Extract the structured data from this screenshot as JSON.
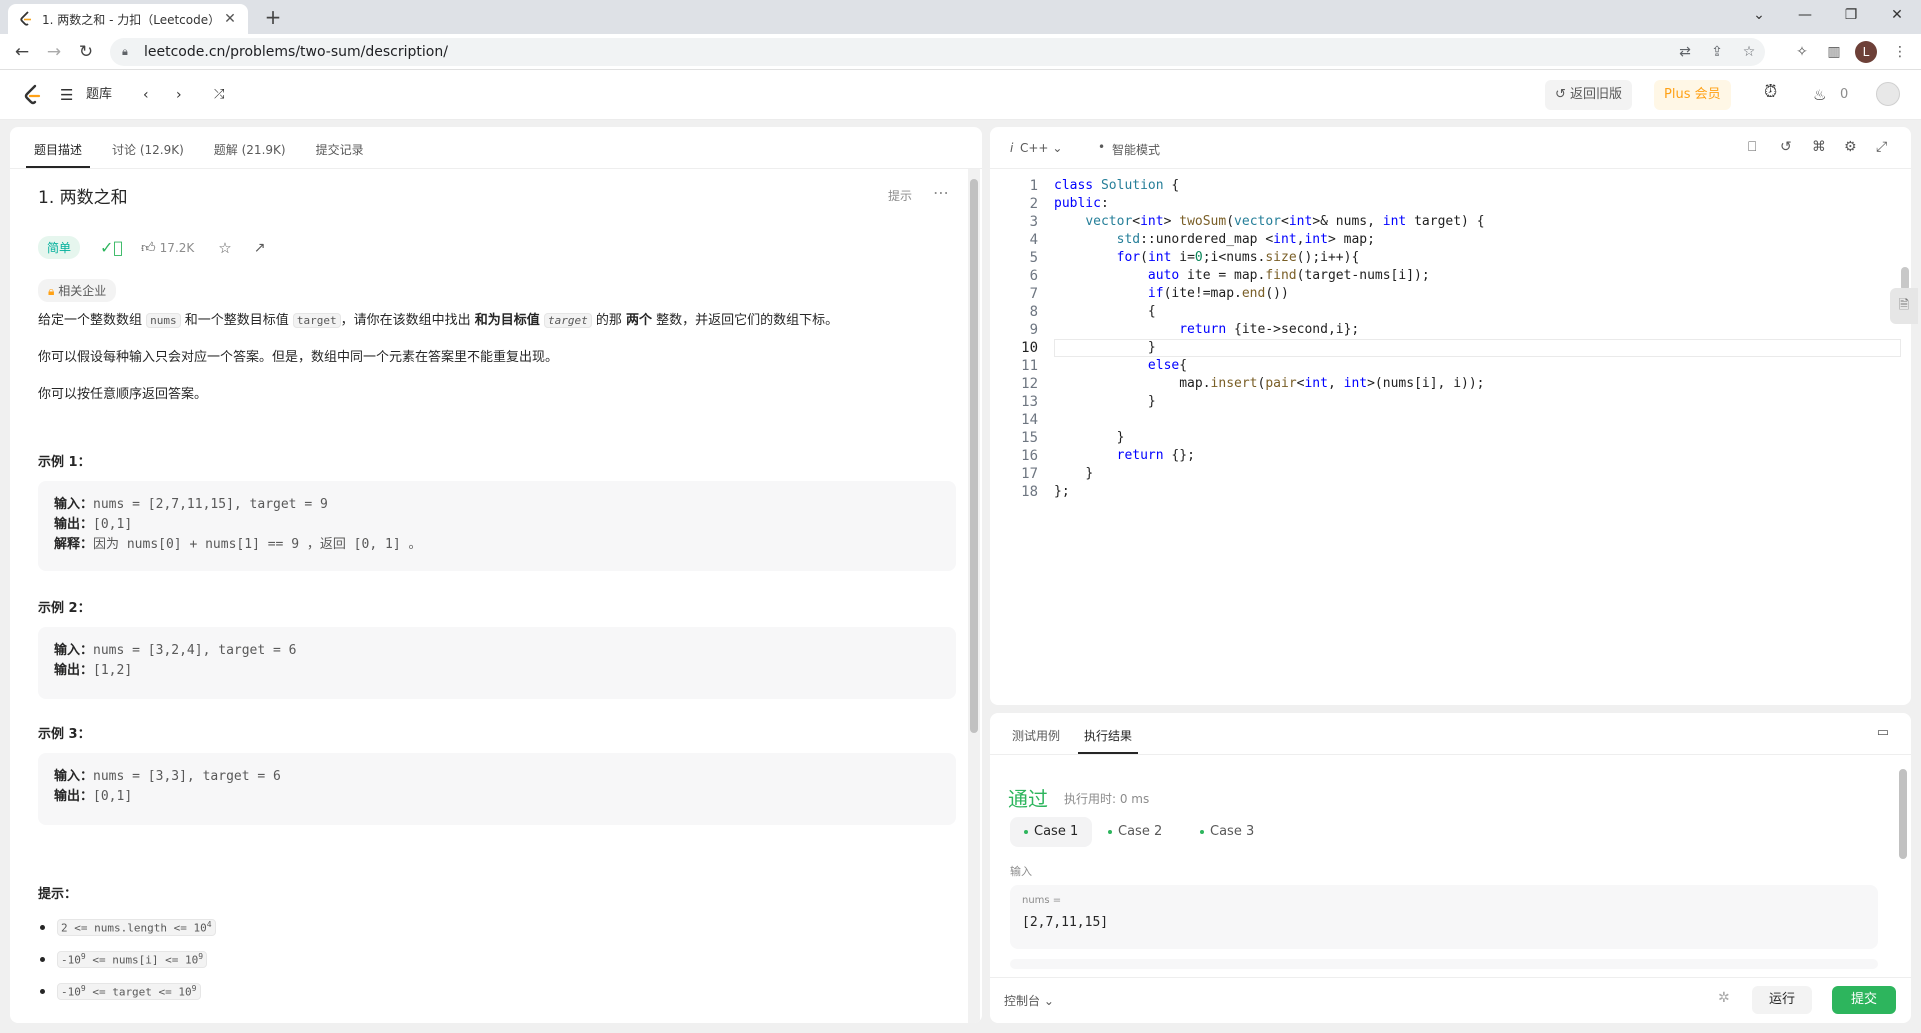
{
  "browser": {
    "tab_title": "1. 两数之和 - 力扣（Leetcode）",
    "url": "leetcode.cn/problems/two-sum/description/",
    "profile_initial": "L"
  },
  "header": {
    "problem_list": "题库",
    "back_to_old": "返回旧版",
    "plus": "Plus 会员",
    "streak": "0"
  },
  "left_tabs": [
    "题目描述",
    "讨论 (12.9K)",
    "题解 (21.9K)",
    "提交记录"
  ],
  "problem": {
    "title": "1. 两数之和",
    "hint": "提示",
    "difficulty": "简单",
    "likes": "17.2K",
    "company_tag": "相关企业",
    "para1": {
      "a": "给定一个整数数组 ",
      "nums": "nums",
      "b": " 和一个整数目标值 ",
      "target": "target",
      "c": "，请你在该数组中找出 ",
      "bold1": "和为目标值",
      "target_it": "target",
      "d": " 的那 ",
      "bold2": "两个",
      "e": " 整数，并返回它们的数组下标。"
    },
    "para2": "你可以假设每种输入只会对应一个答案。但是，数组中同一个元素在答案里不能重复出现。",
    "para3": "你可以按任意顺序返回答案。",
    "examples": [
      {
        "heading": "示例 1：",
        "in_label": "输入：",
        "in": "nums = [2,7,11,15], target = 9",
        "out_label": "输出：",
        "out": "[0,1]",
        "exp_label": "解释：",
        "exp": "因为 nums[0] + nums[1] == 9 ，返回 [0, 1] 。"
      },
      {
        "heading": "示例 2：",
        "in_label": "输入：",
        "in": "nums = [3,2,4], target = 6",
        "out_label": "输出：",
        "out": "[1,2]"
      },
      {
        "heading": "示例 3：",
        "in_label": "输入：",
        "in": "nums = [3,3], target = 6",
        "out_label": "输出：",
        "out": "[0,1]"
      }
    ],
    "constraints_heading": "提示：",
    "constraints": [
      {
        "a": "2 <= nums.length <= 10",
        "sup": "4",
        "b": ""
      },
      {
        "a": "-10",
        "sup": "9",
        "b": " <= nums[i] <= 10",
        "sup2": "9"
      },
      {
        "a": "-10",
        "sup": "9",
        "b": " <= target <= 10",
        "sup2": "9"
      }
    ]
  },
  "editor": {
    "language": "C++",
    "mode": "智能模式",
    "current_line": 10
  },
  "results": {
    "tabs": [
      "测试用例",
      "执行结果"
    ],
    "status": "通过",
    "runtime": "执行用时: 0 ms",
    "cases": [
      "Case 1",
      "Case 2",
      "Case 3"
    ],
    "input_label": "输入",
    "var_name": "nums =",
    "var_value": "[2,7,11,15]",
    "console": "控制台",
    "run": "运行",
    "submit": "提交"
  },
  "colors": {
    "accent_green": "#2db55d",
    "easy": "#00af9b",
    "plus": "#ffa116"
  }
}
